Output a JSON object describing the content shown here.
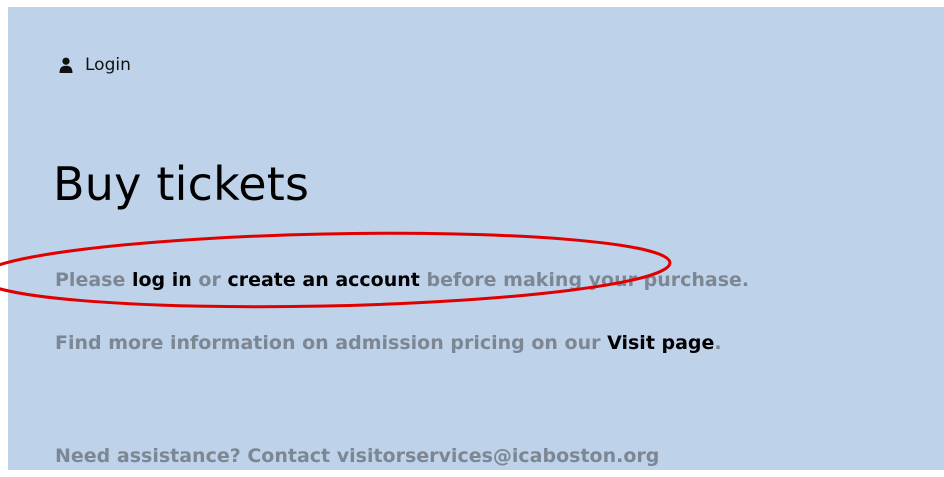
{
  "header": {
    "login_label": "Login",
    "login_icon": "user-icon"
  },
  "main": {
    "title": "Buy tickets",
    "para1": {
      "prefix": "Please ",
      "login_link": "log in",
      "or": " or ",
      "account_link": "create an account",
      "suffix": " before making your purchase."
    },
    "para2": {
      "prefix": "Find more information on admission pricing on our ",
      "visit_link": "Visit page",
      "suffix": "."
    },
    "assistance": "Need assistance? Contact visitorservices@icaboston.org"
  },
  "annotation": {
    "shape": "ellipse",
    "color": "#e00000"
  },
  "colors": {
    "background": "#bed2ea",
    "muted_text": "#7d8794",
    "link_text": "#000000"
  }
}
